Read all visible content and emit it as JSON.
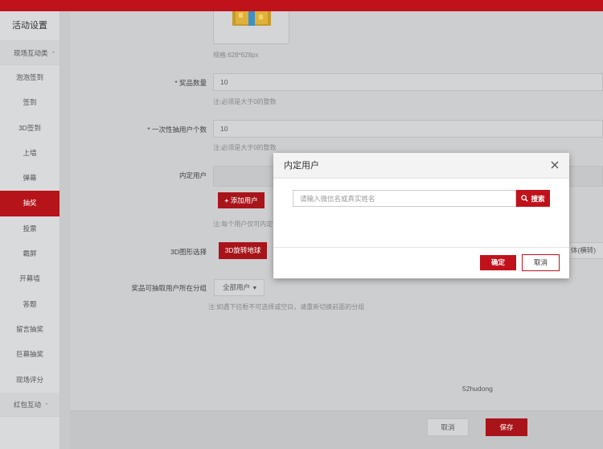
{
  "sidebar": {
    "title": "活动设置",
    "group1": "现场互动类",
    "items": [
      "泡泡签到",
      "签到",
      "3D签到",
      "上墙",
      "弹幕",
      "抽奖",
      "投票",
      "霸屏",
      "开幕墙",
      "答题",
      "留言抽奖",
      "巨幕抽奖",
      "现场评分"
    ],
    "active_item": "抽奖",
    "group2": "红包互动"
  },
  "form": {
    "size_note": "规格:628*628px",
    "prize_count_label": "* 奖品数量",
    "prize_count_value": "10",
    "prize_count_note": "注:必须是大于0的整数",
    "per_draw_label": "* 一次性抽用户个数",
    "per_draw_value": "10",
    "per_draw_note": "注:必须是大于0的整数",
    "internal_label": "内定用户",
    "add_user_label": "添加用户",
    "internal_note": "注:每个用户仅可内定",
    "shape_label": "3D图形选择",
    "shape_btn": "3D旋转地球",
    "shape_right": "体(横转)",
    "group_label": "奖品可抽取用户所在分组",
    "group_value": "全部用户",
    "group_note": "注:如遇下拉框不可选择或空白，请重新切换前面的分组",
    "watermark": "52hudong"
  },
  "footer": {
    "cancel": "取消",
    "save": "保存"
  },
  "modal": {
    "title": "内定用户",
    "search_placeholder": "请输入微信名或真实姓名",
    "search_btn": "搜索",
    "confirm": "确定",
    "cancel": "取消"
  },
  "colors": {
    "brand_red": "#c0121b"
  }
}
